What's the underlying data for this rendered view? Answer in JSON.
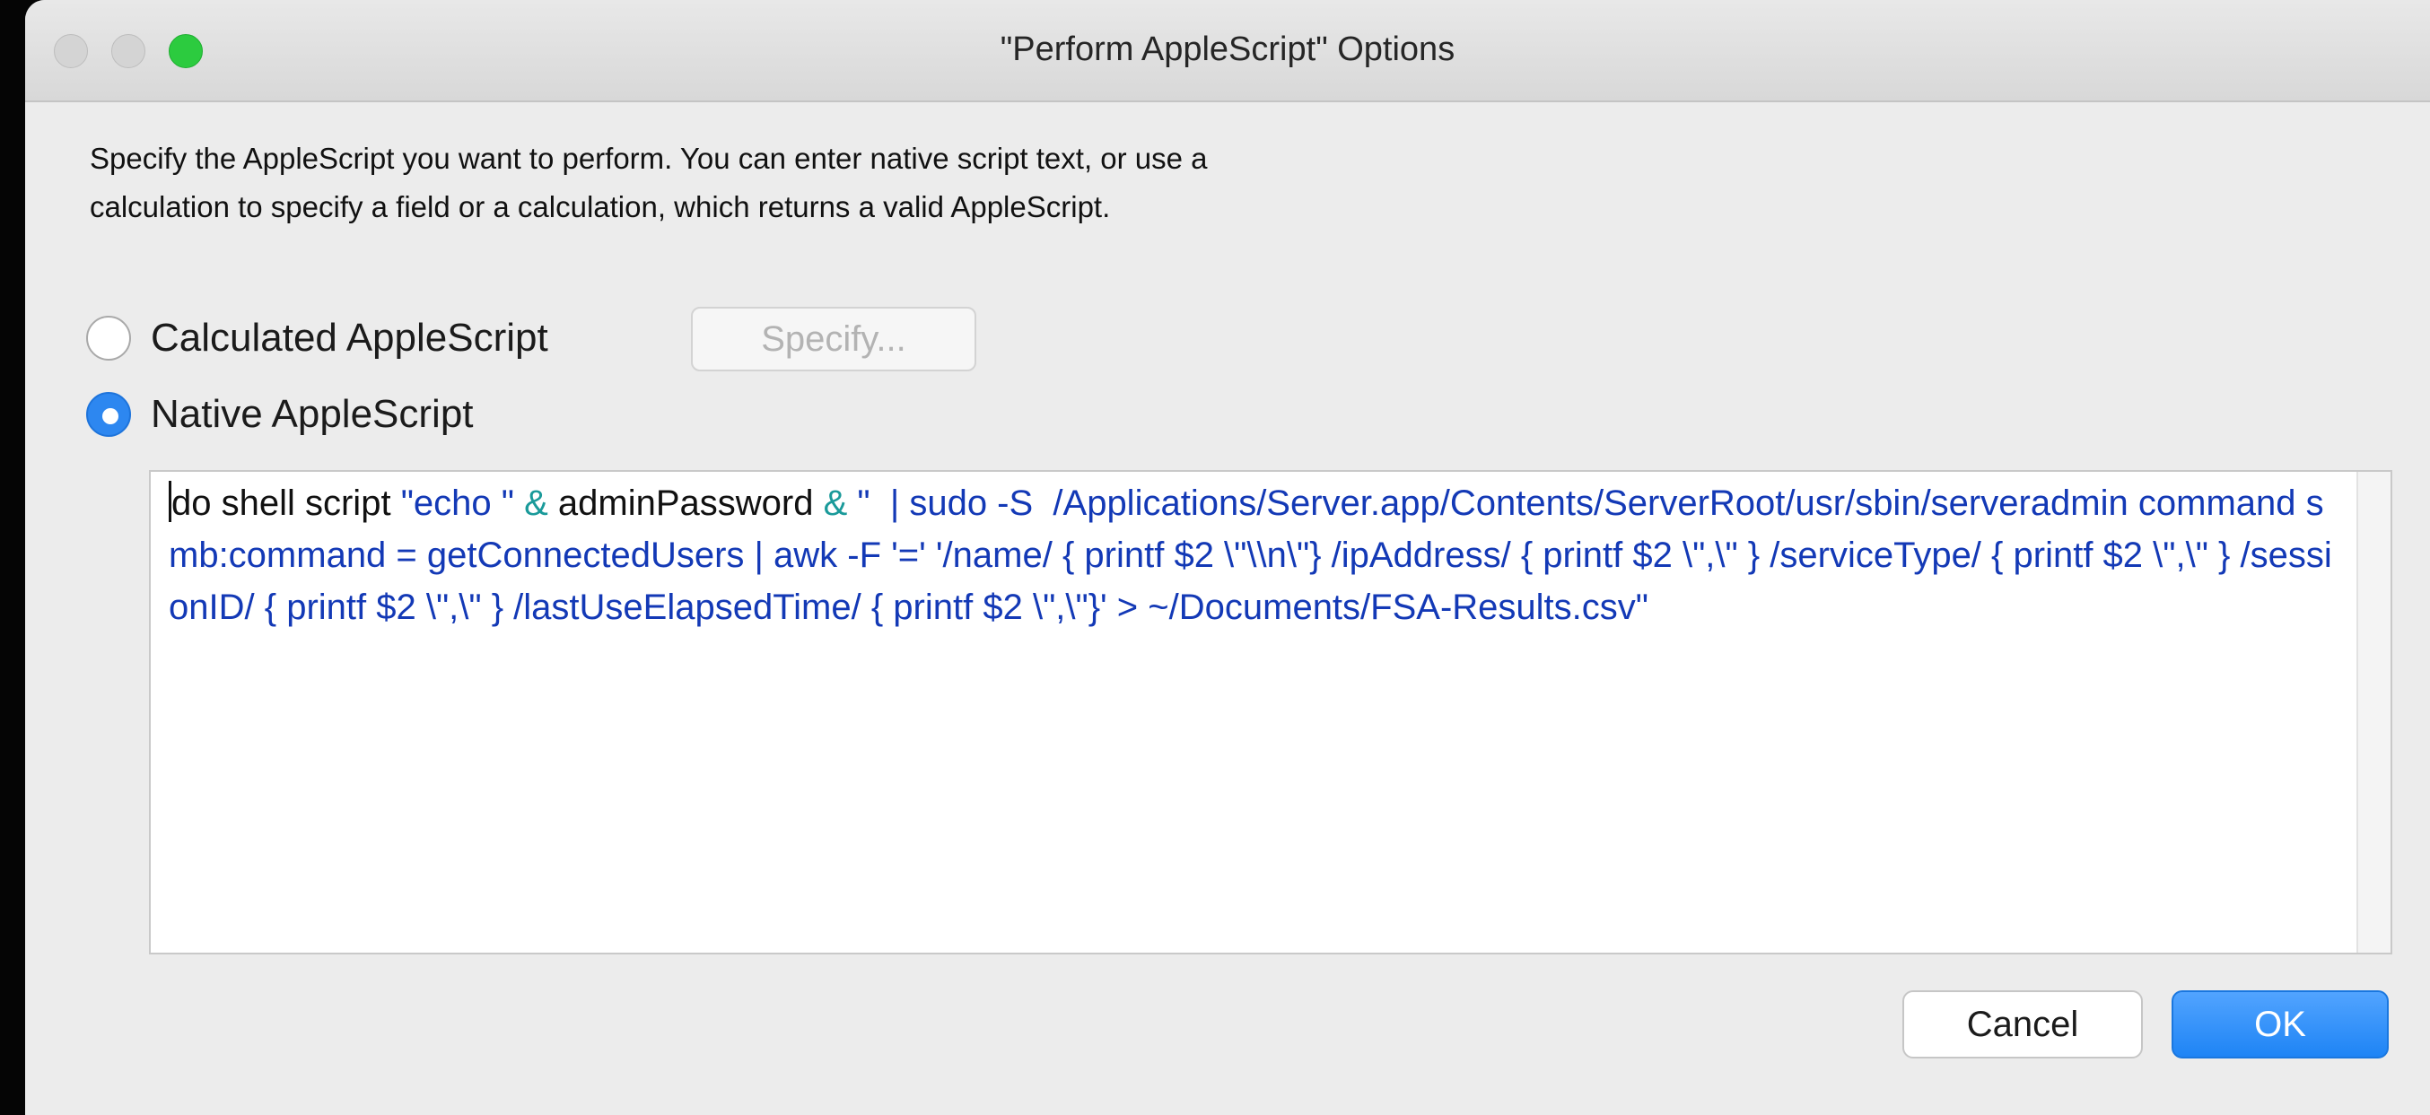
{
  "window": {
    "title": "\"Perform AppleScript\" Options"
  },
  "description": {
    "line1": "Specify the AppleScript you want to perform. You can enter native script text, or use a",
    "line2": "calculation to specify a field or a calculation, which returns a valid AppleScript."
  },
  "options": {
    "calculated_label": "Calculated AppleScript",
    "calculated_selected": false,
    "specify_label": "Specify...",
    "native_label": "Native AppleScript",
    "native_selected": true
  },
  "script": {
    "keyword1": "do shell script",
    "str1": "\"echo \"",
    "op1": "&",
    "var1": "adminPassword",
    "op2": "&",
    "str2": "\"  | sudo -S  /Applications/Server.app/Contents/ServerRoot/usr/sbin/serveradmin command smb:command = getConnectedUsers | awk -F '=' '/name/ { printf $2 \\\"\\\\n\\\"} /ipAddress/ { printf $2 \\\",\\\" } /serviceType/ { printf $2 \\\",\\\" } /sessionID/ { printf $2 \\\",\\\" } /lastUseElapsedTime/ { printf $2 \\\",\\\"}' > ~/Documents/FSA-Results.csv\""
  },
  "buttons": {
    "cancel": "Cancel",
    "ok": "OK"
  },
  "colors": {
    "accent": "#1e84f5",
    "string": "#1339b6",
    "operator": "#1a9a9a"
  }
}
